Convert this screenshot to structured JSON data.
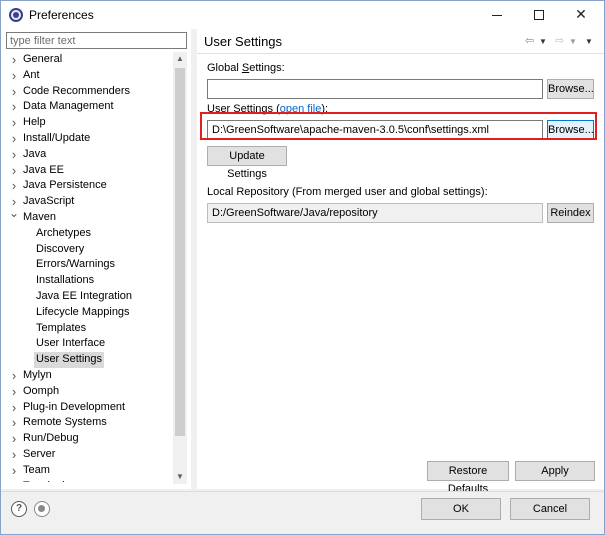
{
  "window": {
    "title": "Preferences",
    "controls": {
      "minimize": "minimize",
      "maximize": "maximize",
      "close": "✕"
    }
  },
  "filter": {
    "placeholder": "type filter text",
    "value": ""
  },
  "tree": {
    "items": [
      {
        "label": "General",
        "level": 0,
        "state": "collapsed"
      },
      {
        "label": "Ant",
        "level": 0,
        "state": "collapsed"
      },
      {
        "label": "Code Recommenders",
        "level": 0,
        "state": "collapsed"
      },
      {
        "label": "Data Management",
        "level": 0,
        "state": "collapsed"
      },
      {
        "label": "Help",
        "level": 0,
        "state": "collapsed"
      },
      {
        "label": "Install/Update",
        "level": 0,
        "state": "collapsed"
      },
      {
        "label": "Java",
        "level": 0,
        "state": "collapsed"
      },
      {
        "label": "Java EE",
        "level": 0,
        "state": "collapsed"
      },
      {
        "label": "Java Persistence",
        "level": 0,
        "state": "collapsed"
      },
      {
        "label": "JavaScript",
        "level": 0,
        "state": "collapsed"
      },
      {
        "label": "Maven",
        "level": 0,
        "state": "expanded"
      },
      {
        "label": "Archetypes",
        "level": 1,
        "state": "leaf"
      },
      {
        "label": "Discovery",
        "level": 1,
        "state": "leaf"
      },
      {
        "label": "Errors/Warnings",
        "level": 1,
        "state": "leaf"
      },
      {
        "label": "Installations",
        "level": 1,
        "state": "leaf"
      },
      {
        "label": "Java EE Integration",
        "level": 1,
        "state": "leaf"
      },
      {
        "label": "Lifecycle Mappings",
        "level": 1,
        "state": "leaf"
      },
      {
        "label": "Templates",
        "level": 1,
        "state": "leaf"
      },
      {
        "label": "User Interface",
        "level": 1,
        "state": "leaf"
      },
      {
        "label": "User Settings",
        "level": 1,
        "state": "leaf",
        "selected": true
      },
      {
        "label": "Mylyn",
        "level": 0,
        "state": "collapsed"
      },
      {
        "label": "Oomph",
        "level": 0,
        "state": "collapsed"
      },
      {
        "label": "Plug-in Development",
        "level": 0,
        "state": "collapsed"
      },
      {
        "label": "Remote Systems",
        "level": 0,
        "state": "collapsed"
      },
      {
        "label": "Run/Debug",
        "level": 0,
        "state": "collapsed"
      },
      {
        "label": "Server",
        "level": 0,
        "state": "collapsed"
      },
      {
        "label": "Team",
        "level": 0,
        "state": "collapsed"
      },
      {
        "label": "Terminal",
        "level": 0,
        "state": "collapsed"
      }
    ],
    "icons": {
      "collapsed": "chevron-right-icon",
      "expanded": "chevron-down-icon"
    }
  },
  "page": {
    "title": "User Settings",
    "global_settings": {
      "label_prefix": "Global ",
      "label_mnemonic": "S",
      "label_suffix": "ettings:",
      "value": "",
      "browse_label": "Browse..."
    },
    "user_settings": {
      "label_prefix": "User Settings (",
      "link_text": "open file",
      "label_suffix": "):",
      "value": "D:\\GreenSoftware\\apache-maven-3.0.5\\conf\\settings.xml",
      "browse_label": "Browse..."
    },
    "update_settings_label": "Update Settings",
    "local_repository": {
      "label": "Local Repository (From merged user and global settings):",
      "value": "D:/GreenSoftware/Java/repository",
      "reindex_label": "Reindex"
    },
    "restore_defaults_label": "Restore Defaults",
    "apply_label": "Apply"
  },
  "footer": {
    "ok_label": "OK",
    "cancel_label": "Cancel"
  },
  "colors": {
    "highlight_box": "#e02020",
    "link": "#0066cc",
    "focus": "#0078d7"
  }
}
